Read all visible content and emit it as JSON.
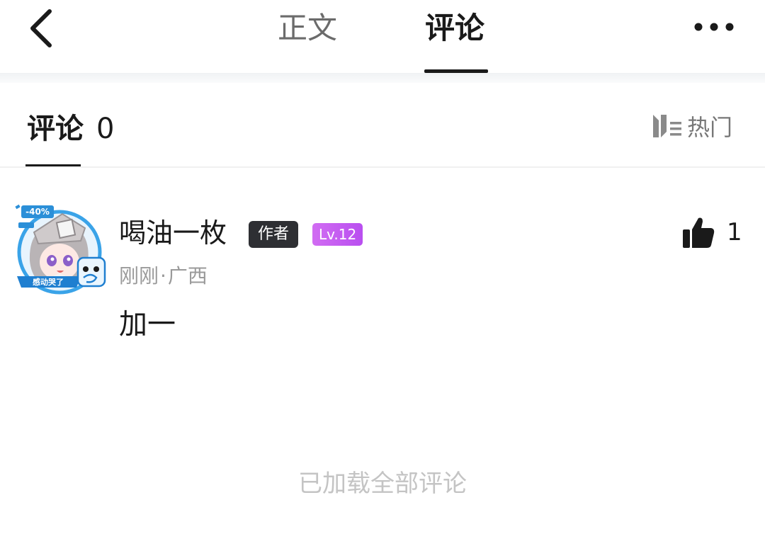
{
  "header": {
    "tabs": [
      {
        "label": "正文",
        "active": false
      },
      {
        "label": "评论",
        "active": true
      }
    ],
    "icons": {
      "back": "chevron-left-icon",
      "more": "more-horizontal-icon"
    }
  },
  "comments_section": {
    "title": "评论",
    "count": "0",
    "sort": {
      "label": "热门",
      "icon": "sort-icon"
    }
  },
  "comments": [
    {
      "username": "喝油一枚",
      "author_badge": "作者",
      "level_badge": "Lv.12",
      "time": "刚刚",
      "location": "广西",
      "text": "加一",
      "likes": "1",
      "avatar_frame": {
        "discount_tag": "-40%",
        "banner_text": "感动哭了"
      }
    }
  ],
  "footer": {
    "loaded_all": "已加载全部评论"
  },
  "colors": {
    "accent": "#1a1a1a",
    "muted": "#9a9a9a",
    "author_badge_bg": "#2e2f33",
    "level_badge_bg": "#c95ff1"
  }
}
